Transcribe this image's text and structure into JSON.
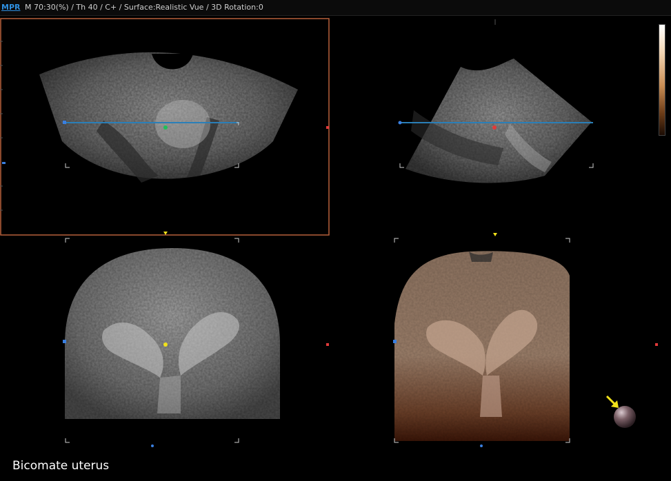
{
  "header": {
    "mode_tab": "MPR",
    "params": "M 70:30(%) / Th 40 / C+ / Surface:Realistic Vue / 3D Rotation:0"
  },
  "caption": "Bicomate uterus",
  "colors": {
    "active_frame": "#b8603a",
    "reference_line": "#2a7fb8",
    "marker_green": "#1fbf5a",
    "marker_red": "#e03a3a",
    "marker_yellow": "#f2e21a",
    "marker_blue": "#3a7fe0",
    "rotation_arrow": "#f2e21a"
  },
  "icons": {
    "orientation_sphere": "orientation-sphere-icon",
    "rotation_arrow": "arrow-icon"
  }
}
